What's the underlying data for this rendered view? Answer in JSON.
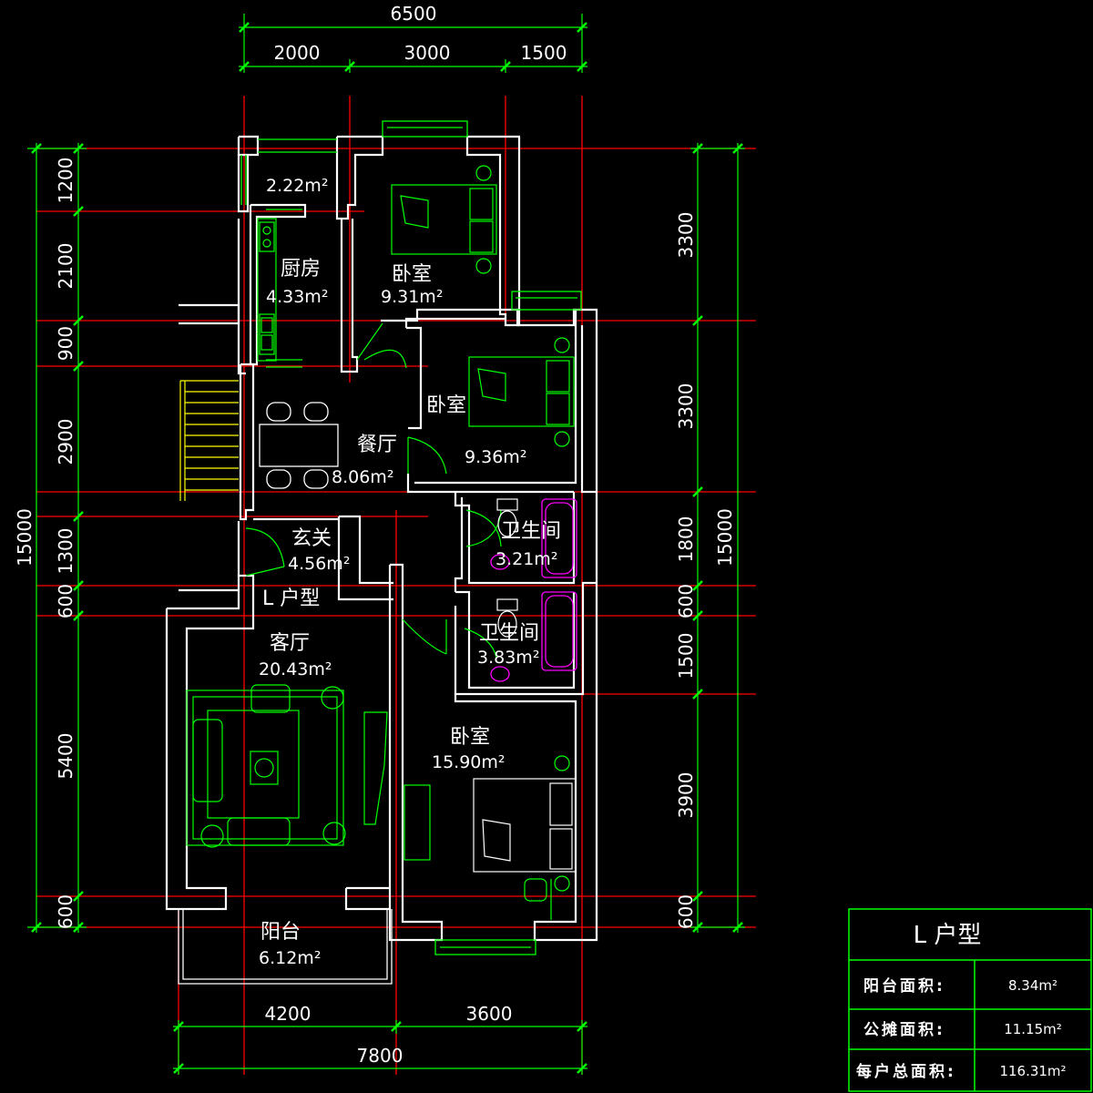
{
  "colors": {
    "background": "#000000",
    "wall": "#ffffff",
    "axis": "#ff0000",
    "dimension": "#00ff00",
    "furniture": "#00ff00",
    "fixture": "#ff00ff",
    "stair": "#ffff00"
  },
  "dimensions": {
    "top_total": "6500",
    "top_segments": [
      "2000",
      "3000",
      "1500"
    ],
    "bottom_segments": [
      "4200",
      "3600"
    ],
    "bottom_total": "7800",
    "left_total": "15000",
    "left_segments": [
      "1200",
      "2100",
      "900",
      "2900",
      "1300",
      "600",
      "5400",
      "600"
    ],
    "right_total": "15000",
    "right_segments": [
      "3300",
      "3300",
      "1800",
      "600",
      "1500",
      "3900",
      "600"
    ]
  },
  "rooms": {
    "balcony_top": {
      "area": "2.22m²"
    },
    "kitchen": {
      "name": "厨房",
      "area": "4.33m²"
    },
    "bedroom_top": {
      "name": "卧室",
      "area": "9.31m²"
    },
    "bedroom_mid": {
      "name": "卧室",
      "area": "9.36m²"
    },
    "dining": {
      "name": "餐厅",
      "area": "8.06m²"
    },
    "foyer": {
      "name": "玄关",
      "area": "4.56m²"
    },
    "bath1": {
      "name": "卫生间",
      "area": "3.21m²"
    },
    "bath2": {
      "name": "卫生间",
      "area": "3.83m²"
    },
    "living": {
      "name": "客厅",
      "area": "20.43m²"
    },
    "bedroom_master": {
      "name": "卧室",
      "area": "15.90m²"
    },
    "balcony": {
      "name": "阳台",
      "area": "6.12m²"
    }
  },
  "type_label": "L 户型",
  "summary_table": {
    "title": "L 户型",
    "rows": [
      {
        "label": "阳台面积:",
        "value": "8.34m²"
      },
      {
        "label": "公摊面积:",
        "value": "11.15m²"
      },
      {
        "label": "每户总面积:",
        "value": "116.31m²"
      }
    ]
  }
}
